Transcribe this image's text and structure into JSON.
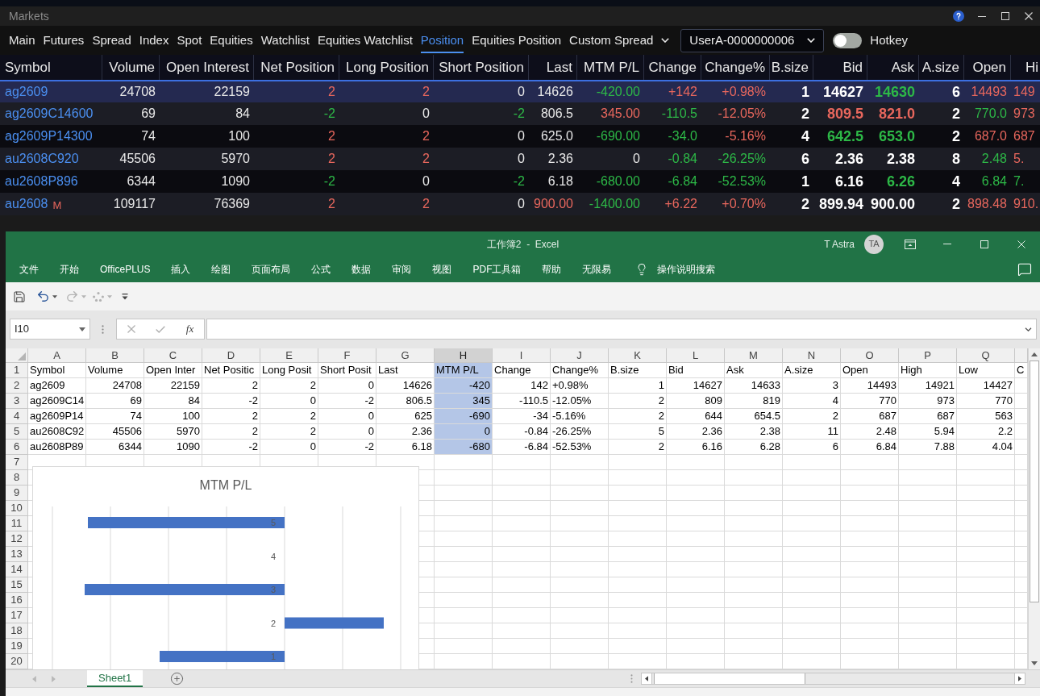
{
  "markets": {
    "title": "Markets",
    "tabs": [
      {
        "label": "Main",
        "selected": false,
        "kind": "tab"
      },
      {
        "label": "Futures",
        "selected": false,
        "kind": "tab"
      },
      {
        "label": "Spread",
        "selected": false,
        "kind": "tab"
      },
      {
        "label": "Index",
        "selected": false,
        "kind": "tab"
      },
      {
        "label": "Spot",
        "selected": false,
        "kind": "tab"
      },
      {
        "label": "Equities",
        "selected": false,
        "kind": "tab"
      },
      {
        "label": "Watchlist",
        "selected": false,
        "kind": "tab"
      },
      {
        "label": "Equities Watchlist",
        "selected": false,
        "kind": "tab"
      },
      {
        "label": "Position",
        "selected": true,
        "kind": "tab"
      },
      {
        "label": "Equities Position",
        "selected": false,
        "kind": "tab"
      },
      {
        "label": "Custom Spread",
        "selected": false,
        "kind": "menu"
      }
    ],
    "account": {
      "value": "UserA-0000000006"
    },
    "hotkey": {
      "label": "Hotkey",
      "on": false
    },
    "table": {
      "columns": [
        {
          "label": "Symbol",
          "bold": false
        },
        {
          "label": "Volume",
          "bold": false
        },
        {
          "label": "Open Interest",
          "bold": false
        },
        {
          "label": "Net Position",
          "bold": false
        },
        {
          "label": "Long Position",
          "bold": false
        },
        {
          "label": "Short Position",
          "bold": false
        },
        {
          "label": "Last",
          "bold": false
        },
        {
          "label": "MTM P/L",
          "bold": false
        },
        {
          "label": "Change",
          "bold": false
        },
        {
          "label": "Change%",
          "bold": false
        },
        {
          "label": "B.size",
          "bold": true
        },
        {
          "label": "Bid",
          "bold": true
        },
        {
          "label": "Ask",
          "bold": true
        },
        {
          "label": "A.size",
          "bold": true
        },
        {
          "label": "Open",
          "bold": false
        },
        {
          "label": "Hi",
          "bold": false
        }
      ],
      "rows": [
        {
          "selected": true,
          "cells": [
            {
              "text": "ag2609",
              "color": "#4b8ff0"
            },
            {
              "text": "24708"
            },
            {
              "text": "22159"
            },
            {
              "text": "2",
              "color": "#e8675d"
            },
            {
              "text": "2",
              "color": "#e8675d"
            },
            {
              "text": "0"
            },
            {
              "text": "14626"
            },
            {
              "text": "-420.00",
              "color": "#2db847"
            },
            {
              "text": "+142",
              "color": "#e8675d"
            },
            {
              "text": "+0.98%",
              "color": "#e8675d"
            },
            {
              "text": "1"
            },
            {
              "text": "14627"
            },
            {
              "text": "14630",
              "color": "#2db847"
            },
            {
              "text": "6"
            },
            {
              "text": "14493",
              "color": "#e8675d"
            },
            {
              "text": "149",
              "color": "#e8675d"
            }
          ]
        },
        {
          "selected": false,
          "cells": [
            {
              "text": "ag2609C14600",
              "color": "#4b8ff0"
            },
            {
              "text": "69"
            },
            {
              "text": "84"
            },
            {
              "text": "-2",
              "color": "#2db847"
            },
            {
              "text": "0"
            },
            {
              "text": "-2",
              "color": "#2db847"
            },
            {
              "text": "806.5"
            },
            {
              "text": "345.00",
              "color": "#e8675d"
            },
            {
              "text": "-110.5",
              "color": "#2db847"
            },
            {
              "text": "-12.05%",
              "color": "#e8675d"
            },
            {
              "text": "2"
            },
            {
              "text": "809.5",
              "color": "#e8675d"
            },
            {
              "text": "821.0",
              "color": "#e8675d"
            },
            {
              "text": "2"
            },
            {
              "text": "770.0",
              "color": "#2db847"
            },
            {
              "text": "973",
              "color": "#e8675d"
            }
          ]
        },
        {
          "selected": false,
          "cells": [
            {
              "text": "ag2609P14300",
              "color": "#4b8ff0"
            },
            {
              "text": "74"
            },
            {
              "text": "100"
            },
            {
              "text": "2",
              "color": "#e8675d"
            },
            {
              "text": "2",
              "color": "#e8675d"
            },
            {
              "text": "0"
            },
            {
              "text": "625.0"
            },
            {
              "text": "-690.00",
              "color": "#2db847"
            },
            {
              "text": "-34.0",
              "color": "#2db847"
            },
            {
              "text": "-5.16%",
              "color": "#e8675d"
            },
            {
              "text": "4"
            },
            {
              "text": "642.5",
              "color": "#2db847"
            },
            {
              "text": "653.0",
              "color": "#2db847"
            },
            {
              "text": "2"
            },
            {
              "text": "687.0",
              "color": "#e8675d"
            },
            {
              "text": "687",
              "color": "#e8675d"
            }
          ]
        },
        {
          "selected": false,
          "cells": [
            {
              "text": "au2608C920",
              "color": "#4b8ff0"
            },
            {
              "text": "45506"
            },
            {
              "text": "5970"
            },
            {
              "text": "2",
              "color": "#e8675d"
            },
            {
              "text": "2",
              "color": "#e8675d"
            },
            {
              "text": "0"
            },
            {
              "text": "2.36"
            },
            {
              "text": "0"
            },
            {
              "text": "-0.84",
              "color": "#2db847"
            },
            {
              "text": "-26.25%",
              "color": "#2db847"
            },
            {
              "text": "6"
            },
            {
              "text": "2.36"
            },
            {
              "text": "2.38"
            },
            {
              "text": "8"
            },
            {
              "text": "2.48",
              "color": "#2db847"
            },
            {
              "text": "5.",
              "color": "#e8675d"
            }
          ]
        },
        {
          "selected": false,
          "cells": [
            {
              "text": "au2608P896",
              "color": "#4b8ff0"
            },
            {
              "text": "6344"
            },
            {
              "text": "1090"
            },
            {
              "text": "-2",
              "color": "#2db847"
            },
            {
              "text": "0"
            },
            {
              "text": "-2",
              "color": "#2db847"
            },
            {
              "text": "6.18"
            },
            {
              "text": "-680.00",
              "color": "#2db847"
            },
            {
              "text": "-6.84",
              "color": "#2db847"
            },
            {
              "text": "-52.53%",
              "color": "#2db847"
            },
            {
              "text": "1"
            },
            {
              "text": "6.16"
            },
            {
              "text": "6.26",
              "color": "#2db847"
            },
            {
              "text": "4"
            },
            {
              "text": "6.84",
              "color": "#2db847"
            },
            {
              "text": "7.",
              "color": "#2db847"
            }
          ]
        },
        {
          "selected": false,
          "flag": {
            "text": "M",
            "color": "#e8675d"
          },
          "cells": [
            {
              "text": "au2608",
              "color": "#4b8ff0"
            },
            {
              "text": "109117"
            },
            {
              "text": "76369"
            },
            {
              "text": "2",
              "color": "#e8675d"
            },
            {
              "text": "2",
              "color": "#e8675d"
            },
            {
              "text": "0"
            },
            {
              "text": "900.00",
              "color": "#e8675d"
            },
            {
              "text": "-1400.00",
              "color": "#2db847"
            },
            {
              "text": "+6.22",
              "color": "#e8675d"
            },
            {
              "text": "+0.70%",
              "color": "#e8675d"
            },
            {
              "text": "2"
            },
            {
              "text": "899.94"
            },
            {
              "text": "900.00"
            },
            {
              "text": "2"
            },
            {
              "text": "898.48",
              "color": "#e8675d"
            },
            {
              "text": "910.",
              "color": "#e8675d"
            }
          ]
        }
      ]
    }
  },
  "excel": {
    "title": "工作簿2  -  Excel",
    "user": {
      "name": "T Astra",
      "initials": "TA"
    },
    "ribbon_tabs": [
      "文件",
      "开始",
      "OfficePLUS",
      "插入",
      "绘图",
      "页面布局",
      "公式",
      "数据",
      "审阅",
      "视图",
      "PDF工具箱",
      "帮助",
      "无限易"
    ],
    "tell_me": "操作说明搜索",
    "quick_access": [
      {
        "kind": "save",
        "disabled": false
      },
      {
        "kind": "undo",
        "disabled": false
      },
      {
        "kind": "redo",
        "disabled": true
      },
      {
        "kind": "touch",
        "disabled": true
      },
      {
        "kind": "customize",
        "disabled": false
      }
    ],
    "name_box": {
      "value": "I10"
    },
    "function_button": "fx",
    "sheet": {
      "columns": [
        {
          "letter": "A",
          "kind": "text",
          "selected": false
        },
        {
          "letter": "B",
          "kind": "number",
          "selected": false
        },
        {
          "letter": "C",
          "kind": "number",
          "selected": false
        },
        {
          "letter": "D",
          "kind": "number",
          "selected": false
        },
        {
          "letter": "E",
          "kind": "number",
          "selected": false
        },
        {
          "letter": "F",
          "kind": "number",
          "selected": false
        },
        {
          "letter": "G",
          "kind": "number",
          "selected": false
        },
        {
          "letter": "H",
          "kind": "number",
          "selected": true
        },
        {
          "letter": "I",
          "kind": "number",
          "selected": false
        },
        {
          "letter": "J",
          "kind": "text",
          "selected": false
        },
        {
          "letter": "K",
          "kind": "number",
          "selected": false
        },
        {
          "letter": "L",
          "kind": "number",
          "selected": false
        },
        {
          "letter": "M",
          "kind": "number",
          "selected": false
        },
        {
          "letter": "N",
          "kind": "number",
          "selected": false
        },
        {
          "letter": "O",
          "kind": "number",
          "selected": false
        },
        {
          "letter": "P",
          "kind": "number",
          "selected": false
        },
        {
          "letter": "Q",
          "kind": "number",
          "selected": false
        },
        {
          "kind": "text",
          "selected": false
        }
      ],
      "rows": [
        {
          "number": "1",
          "kind": "labels",
          "cells": [
            "Symbol",
            "Volume",
            "Open Inter",
            "Net Positic",
            "Long Posit",
            "Short Posit",
            "Last",
            "MTM P/L",
            "Change",
            "Change%",
            "B.size",
            "Bid",
            "Ask",
            "A.size",
            "Open",
            "High",
            "Low",
            "C"
          ]
        },
        {
          "number": "2",
          "kind": "values",
          "cells": [
            "ag2609",
            "24708",
            "22159",
            "2",
            "2",
            "0",
            "14626",
            "-420",
            "142",
            "+0.98%",
            "1",
            "14627",
            "14633",
            "3",
            "14493",
            "14921",
            "14427"
          ]
        },
        {
          "number": "3",
          "kind": "values",
          "cells": [
            "ag2609C14",
            "69",
            "84",
            "-2",
            "0",
            "-2",
            "806.5",
            "345",
            "-110.5",
            "-12.05%",
            "2",
            "809",
            "819",
            "4",
            "770",
            "973",
            "770"
          ]
        },
        {
          "number": "4",
          "kind": "values",
          "cells": [
            "ag2609P14",
            "74",
            "100",
            "2",
            "2",
            "0",
            "625",
            "-690",
            "-34",
            "-5.16%",
            "2",
            "644",
            "654.5",
            "2",
            "687",
            "687",
            "563"
          ]
        },
        {
          "number": "5",
          "kind": "values",
          "cells": [
            "au2608C92",
            "45506",
            "5970",
            "2",
            "2",
            "0",
            "2.36",
            "0",
            "-0.84",
            "-26.25%",
            "5",
            "2.36",
            "2.38",
            "11",
            "2.48",
            "5.94",
            "2.2"
          ]
        },
        {
          "number": "6",
          "kind": "values",
          "cells": [
            "au2608P89",
            "6344",
            "1090",
            "-2",
            "0",
            "-2",
            "6.18",
            "-680",
            "-6.84",
            "-52.53%",
            "2",
            "6.16",
            "6.28",
            "6",
            "6.84",
            "7.88",
            "4.04"
          ]
        },
        {
          "number": "7"
        },
        {
          "number": "8"
        },
        {
          "number": "9"
        },
        {
          "number": "10"
        },
        {
          "number": "11"
        },
        {
          "number": "12"
        },
        {
          "number": "13"
        },
        {
          "number": "14"
        },
        {
          "number": "15"
        },
        {
          "number": "16"
        },
        {
          "number": "17"
        },
        {
          "number": "18"
        },
        {
          "number": "19"
        },
        {
          "number": "20"
        }
      ]
    },
    "chart": {
      "title": "MTM P/L",
      "category_labels": [
        "5",
        "4",
        "3",
        "2",
        "1"
      ]
    },
    "sheet_tabs": [
      {
        "label": "Sheet1",
        "selected": true
      }
    ]
  }
}
